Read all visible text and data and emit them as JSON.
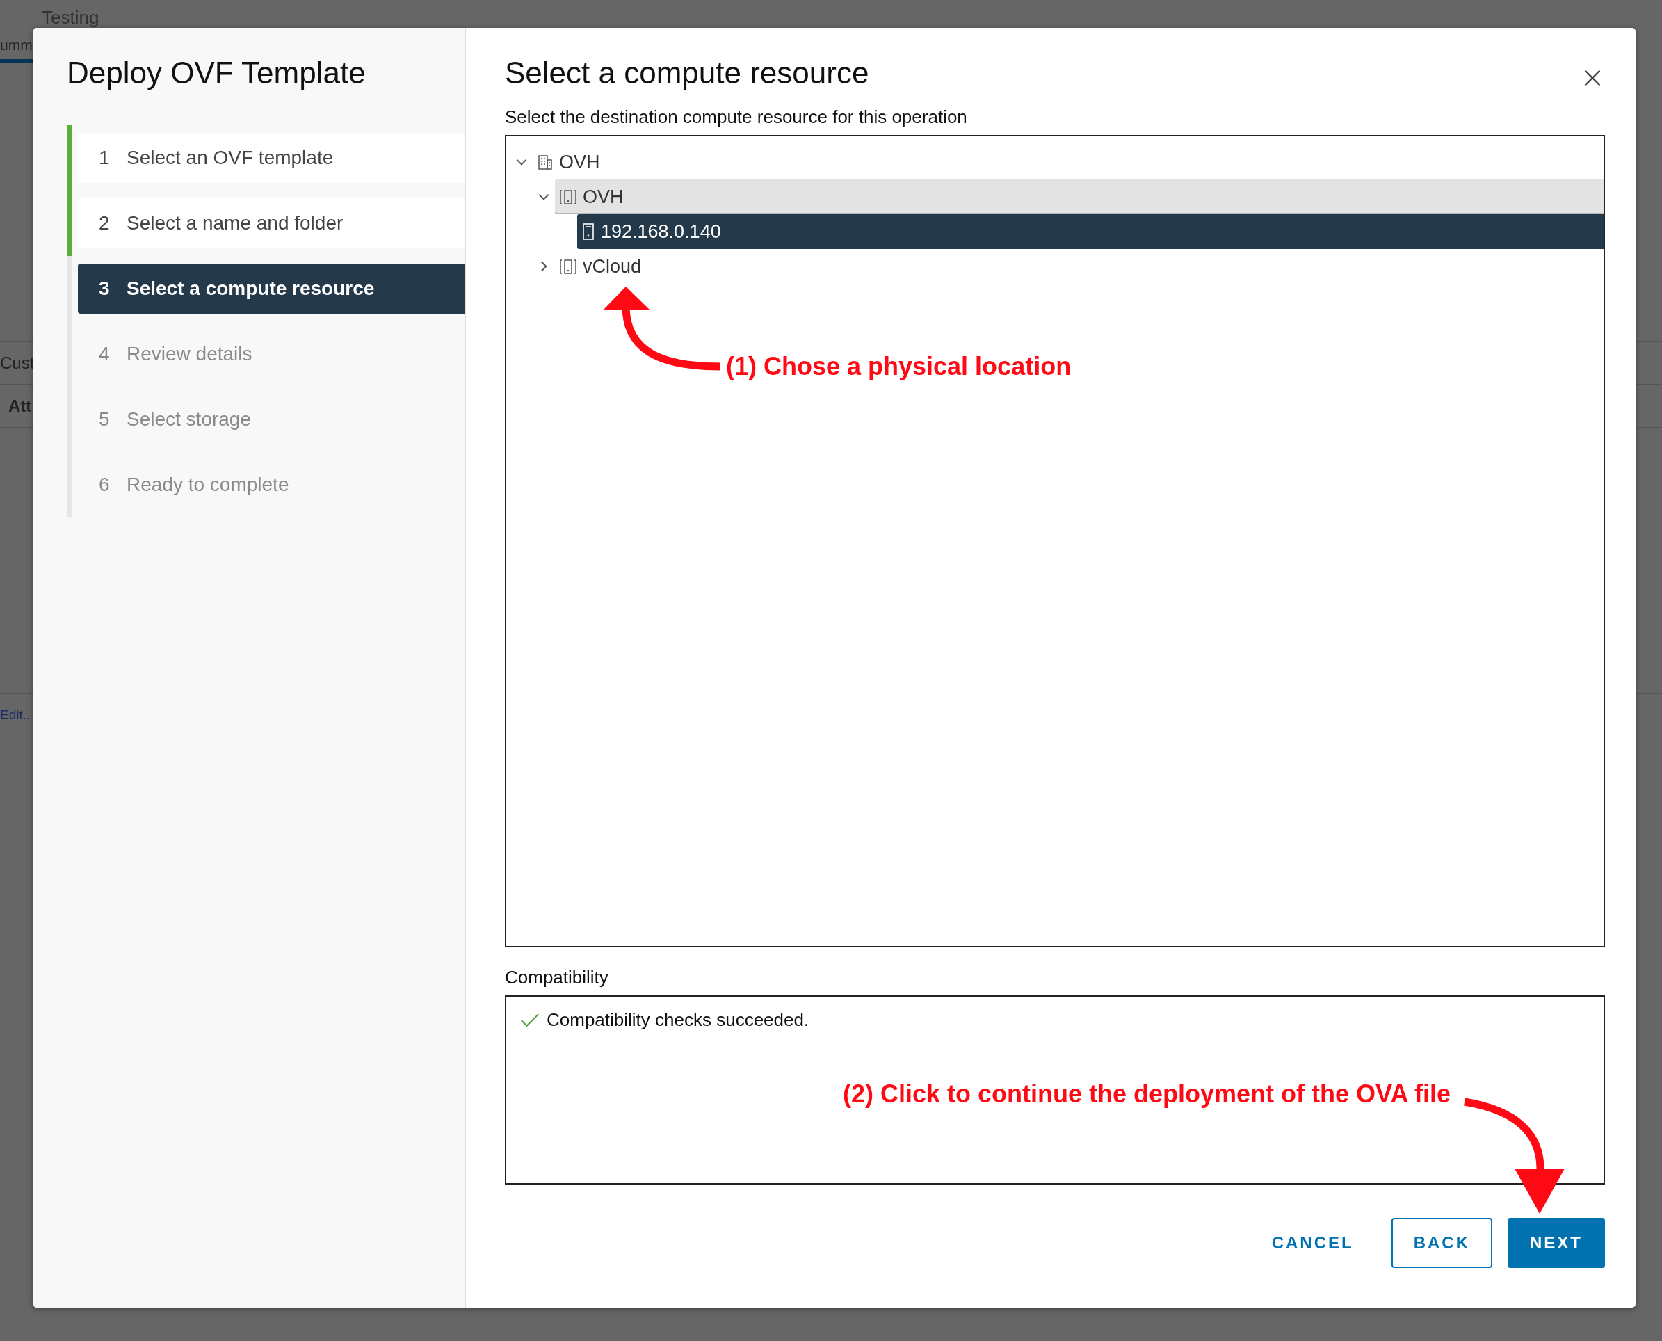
{
  "background": {
    "title": "Testing",
    "tab": "umm",
    "section": "Cust",
    "column": "Att",
    "link": "Edit.."
  },
  "dialog": {
    "title": "Deploy OVF Template",
    "steps": [
      {
        "number": "1",
        "label": "Select an OVF template",
        "completed": true,
        "selected": false
      },
      {
        "number": "2",
        "label": "Select a name and folder",
        "completed": true,
        "selected": false
      },
      {
        "number": "3",
        "label": "Select a compute resource",
        "completed": false,
        "selected": true
      },
      {
        "number": "4",
        "label": "Review details",
        "completed": false,
        "selected": false
      },
      {
        "number": "5",
        "label": "Select storage",
        "completed": false,
        "selected": false
      },
      {
        "number": "6",
        "label": "Ready to complete",
        "completed": false,
        "selected": false
      }
    ],
    "page_title": "Select a compute resource",
    "instruction": "Select the destination compute resource for this operation",
    "tree": [
      {
        "kind": "datacenter",
        "label": "OVH",
        "expanded": true,
        "selected": false,
        "highlighted": false,
        "children": [
          {
            "kind": "cluster",
            "label": "OVH",
            "expanded": true,
            "selected": false,
            "highlighted": true,
            "children": [
              {
                "kind": "host",
                "label": "192.168.0.140",
                "selected": true,
                "highlighted": false
              }
            ]
          },
          {
            "kind": "cluster",
            "label": "vCloud",
            "expanded": false,
            "selected": false,
            "highlighted": false
          }
        ]
      }
    ],
    "compatibility": {
      "label": "Compatibility",
      "message": "Compatibility checks succeeded.",
      "passed": true
    },
    "buttons": [
      {
        "kind": "flat",
        "label": "CANCEL"
      },
      {
        "kind": "outline",
        "label": "BACK"
      },
      {
        "kind": "primary",
        "label": "NEXT"
      }
    ]
  },
  "annotations": [
    {
      "text": "(1) Chose a physical location"
    },
    {
      "text": "(2) Click to continue the deployment of the OVA file"
    }
  ]
}
